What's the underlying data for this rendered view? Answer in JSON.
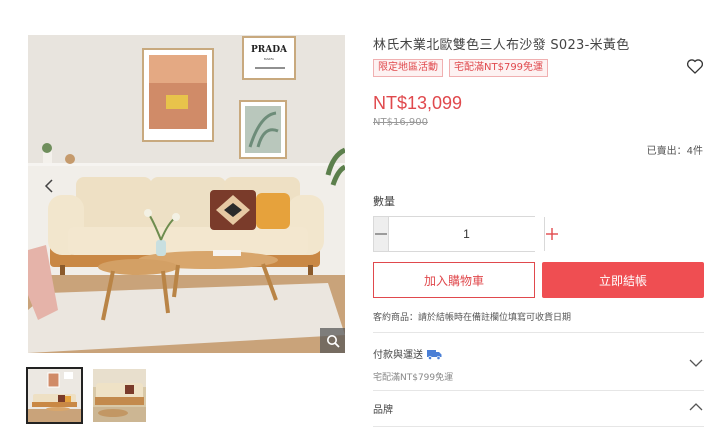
{
  "gallery": {
    "zoom_icon": "magnifier-icon",
    "prev_icon": "chevron-left-icon",
    "poster_brand": "PRADA",
    "poster_sub": "MARFA"
  },
  "product": {
    "title": "林氏木業北歐雙色三人布沙發 S023-米黃色",
    "tags": [
      "限定地區活動",
      "宅配滿NT$799免運"
    ],
    "price": "NT$13,099",
    "original_price": "NT$16,900",
    "sold": "已賣出：4件",
    "wishlist_icon": "heart-outline-icon"
  },
  "quantity": {
    "label": "數量",
    "value": "1",
    "minus_icon": "minus-icon",
    "plus_icon": "plus-icon"
  },
  "actions": {
    "add_to_cart": "加入購物車",
    "buy_now": "立即結帳"
  },
  "note": "客約商品：請於結帳時在備註欄位填寫可收貨日期",
  "sections": {
    "payment": {
      "title": "付款與運送",
      "icon": "delivery-truck-icon",
      "subtitle": "宅配滿NT$799免運"
    },
    "brand": {
      "title": "品牌"
    }
  },
  "colors": {
    "accent": "#ef4e52",
    "price": "#e0494d"
  }
}
